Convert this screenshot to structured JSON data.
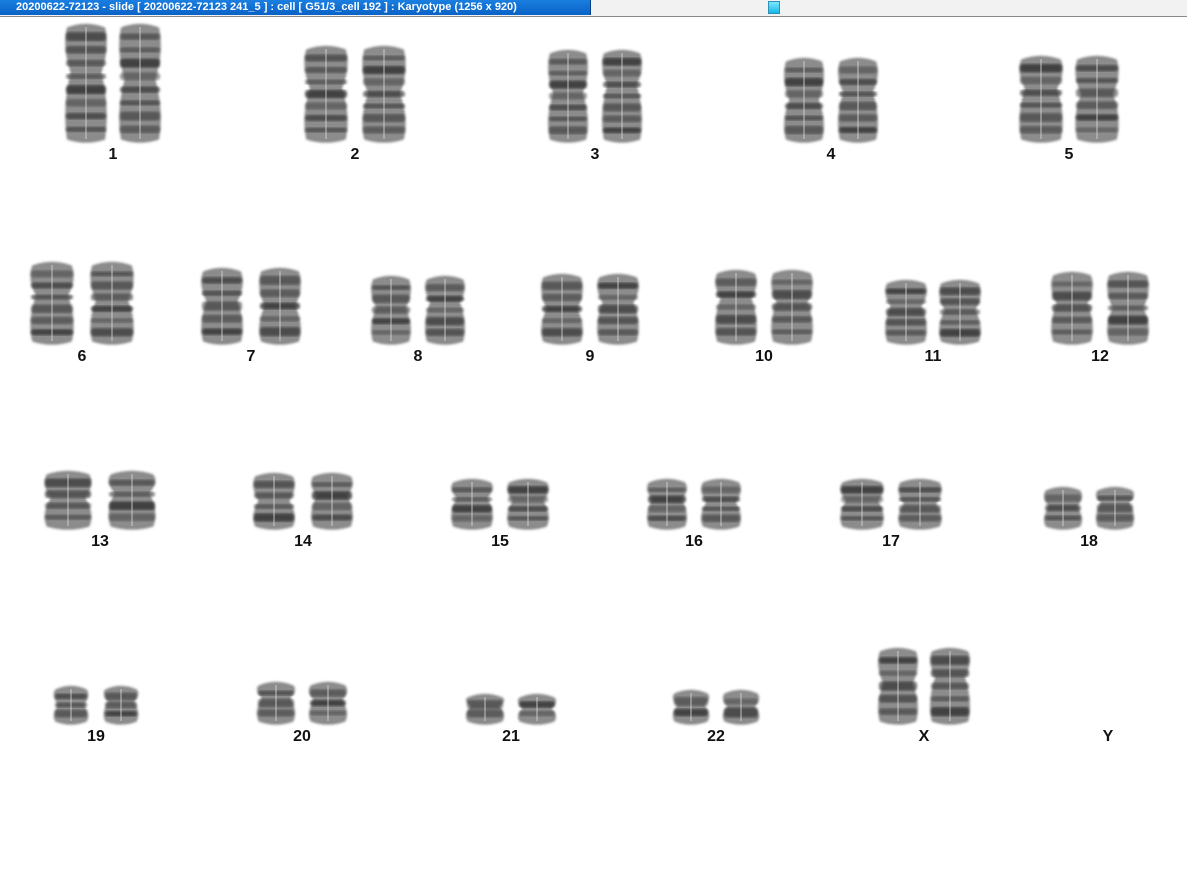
{
  "window": {
    "title": "20200622-72123 - slide [ 20200622-72123 241_5 ] : cell [ G51/3_cell 192 ] : Karyotype  (1256 x 920)"
  },
  "colors": {
    "titlebar": "#0a62c6",
    "chromosome_dark": "#2a2a2a",
    "chromosome_light": "#9a9a9a",
    "label": "#111111"
  },
  "karyotype": {
    "pairs": [
      {
        "label": "1"
      },
      {
        "label": "2"
      },
      {
        "label": "3"
      },
      {
        "label": "4"
      },
      {
        "label": "5"
      },
      {
        "label": "6"
      },
      {
        "label": "7"
      },
      {
        "label": "8"
      },
      {
        "label": "9"
      },
      {
        "label": "10"
      },
      {
        "label": "11"
      },
      {
        "label": "12"
      },
      {
        "label": "13"
      },
      {
        "label": "14"
      },
      {
        "label": "15"
      },
      {
        "label": "16"
      },
      {
        "label": "17"
      },
      {
        "label": "18"
      },
      {
        "label": "19"
      },
      {
        "label": "20"
      },
      {
        "label": "21"
      },
      {
        "label": "22"
      },
      {
        "label": "X"
      },
      {
        "label": "Y"
      }
    ]
  }
}
